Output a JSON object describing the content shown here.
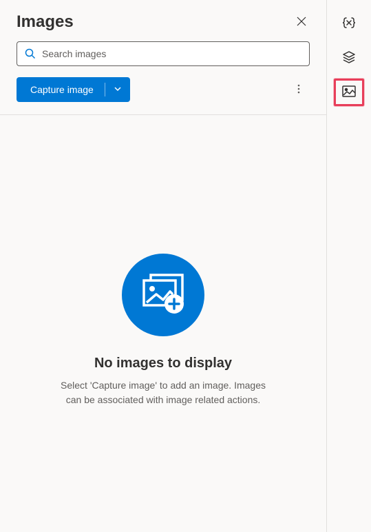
{
  "header": {
    "title": "Images"
  },
  "search": {
    "placeholder": "Search images"
  },
  "toolbar": {
    "capture_label": "Capture image"
  },
  "empty_state": {
    "title": "No images to display",
    "description": "Select 'Capture image' to add an image. Images can be associated with image related actions."
  },
  "rail": {
    "variables_label": "{x}",
    "layers_label": "Layers",
    "images_label": "Images"
  }
}
